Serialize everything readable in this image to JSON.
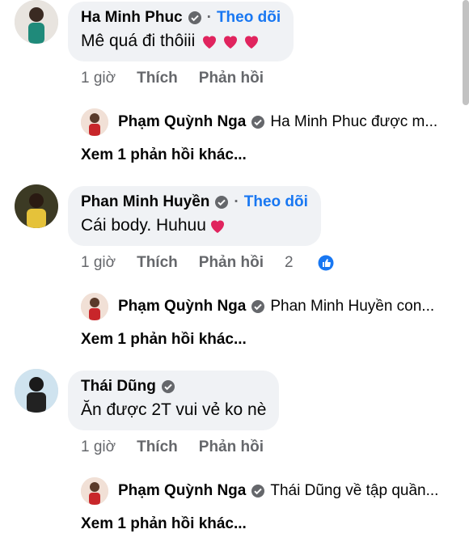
{
  "comments": [
    {
      "name": "Ha Minh Phuc",
      "follow": "Theo dõi",
      "text": "Mê quá đi thôiii",
      "time": "1 giờ",
      "like": "Thích",
      "reply_label": "Phản hồi",
      "reply": {
        "name": "Phạm Quỳnh Nga",
        "text": "Ha Minh Phuc được m..."
      },
      "more": "Xem 1 phản hồi khác..."
    },
    {
      "name": "Phan Minh Huyền",
      "follow": "Theo dõi",
      "text": "Cái body. Huhuu",
      "time": "1 giờ",
      "like": "Thích",
      "reply_label": "Phản hồi",
      "reaction_count": "2",
      "reply": {
        "name": "Phạm Quỳnh Nga",
        "text": "Phan Minh Huyền con..."
      },
      "more": "Xem 1 phản hồi khác..."
    },
    {
      "name": "Thái Dũng",
      "text": "Ăn được 2T vui vẻ ko nè",
      "time": "1 giờ",
      "like": "Thích",
      "reply_label": "Phản hồi",
      "reply": {
        "name": "Phạm Quỳnh Nga",
        "text": "Thái Dũng về tập quần..."
      },
      "more": "Xem 1 phản hồi khác..."
    }
  ],
  "colors": {
    "link": "#1877f2",
    "bubble": "#f0f2f5",
    "muted": "#65676b",
    "heart": "#e0245e"
  }
}
